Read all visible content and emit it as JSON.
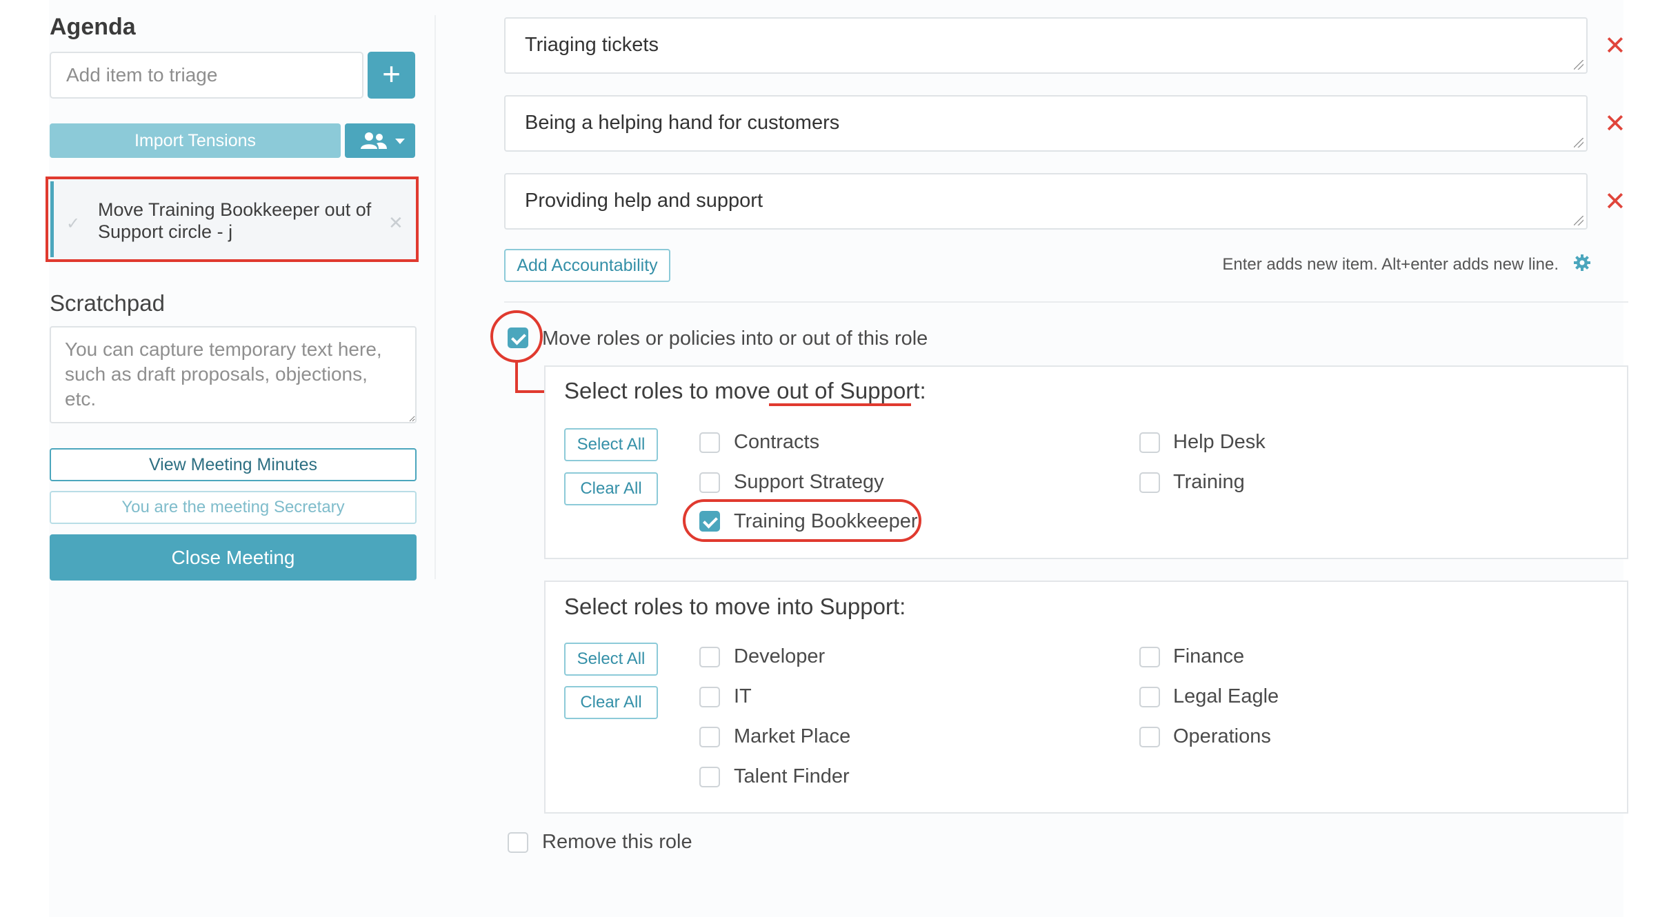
{
  "sidebar": {
    "agenda_title": "Agenda",
    "add_item_placeholder": "Add item to triage",
    "add_icon": "plus-icon",
    "import_button": "Import Tensions",
    "people_icon": "people-icon",
    "agenda_items": [
      {
        "text": "Move Training Bookkeeper out of Support circle - j"
      }
    ],
    "scratchpad_title": "Scratchpad",
    "scratchpad_placeholder": "You can capture temporary text here, such as draft proposals, objections, etc.",
    "view_minutes_button": "View Meeting Minutes",
    "secretary_button": "You are the meeting Secretary",
    "close_meeting_button": "Close Meeting"
  },
  "accountabilities": [
    {
      "text": "Triaging tickets"
    },
    {
      "text": "Being a helping hand for customers"
    },
    {
      "text": "Providing help and support"
    }
  ],
  "add_accountability_button": "Add Accountability",
  "hint_text": "Enter adds new item. Alt+enter adds new line.",
  "move_roles": {
    "label": "Move roles or policies into or out of this role",
    "checked": true,
    "out_panel": {
      "title_prefix": "Select roles to move ",
      "title_emphasis": "out of Support",
      "title_suffix": ":",
      "select_all": "Select All",
      "clear_all": "Clear All",
      "roles": [
        {
          "name": "Contracts",
          "checked": false
        },
        {
          "name": "Support Strategy",
          "checked": false
        },
        {
          "name": "Training Bookkeeper",
          "checked": true
        },
        {
          "name": "Help Desk",
          "checked": false
        },
        {
          "name": "Training",
          "checked": false
        }
      ]
    },
    "into_panel": {
      "title": "Select roles to move into Support:",
      "select_all": "Select All",
      "clear_all": "Clear All",
      "roles": [
        {
          "name": "Developer",
          "checked": false
        },
        {
          "name": "IT",
          "checked": false
        },
        {
          "name": "Market Place",
          "checked": false
        },
        {
          "name": "Talent Finder",
          "checked": false
        },
        {
          "name": "Finance",
          "checked": false
        },
        {
          "name": "Legal Eagle",
          "checked": false
        },
        {
          "name": "Operations",
          "checked": false
        }
      ]
    }
  },
  "remove_role_label": "Remove this role",
  "colors": {
    "accent": "#4ba6bd",
    "highlight": "#e03a2f",
    "delete": "#e0453b"
  }
}
